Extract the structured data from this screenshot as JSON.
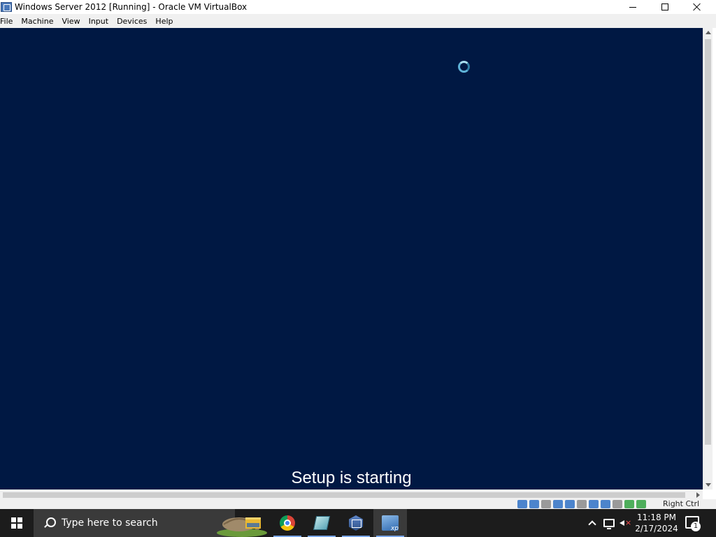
{
  "window": {
    "title": "Windows Server 2012 [Running] - Oracle VM VirtualBox",
    "controls": [
      "minimize",
      "maximize",
      "close"
    ]
  },
  "menu": {
    "items": [
      "File",
      "Machine",
      "View",
      "Input",
      "Devices",
      "Help"
    ]
  },
  "vm": {
    "background_color": "#001843",
    "status_text": "Setup is starting",
    "spinner_icon": "loading-spinner"
  },
  "statusbar": {
    "host_key": "Right Ctrl",
    "icons": [
      "hard-disk-icon",
      "optical-drive-icon",
      "audio-icon",
      "network-icon",
      "usb-icon",
      "shared-folder-icon",
      "display-icon",
      "recording-icon",
      "cpu-icon",
      "mouse-integration-icon",
      "keyboard-icon"
    ]
  },
  "taskbar": {
    "search_placeholder": "Type here to search",
    "apps": [
      "file-explorer",
      "chrome",
      "notepad-book",
      "virtualbox",
      "virtual-machine-xp"
    ],
    "clock_time": "11:18 PM",
    "clock_date": "2/17/2024",
    "notification_count": "1"
  }
}
